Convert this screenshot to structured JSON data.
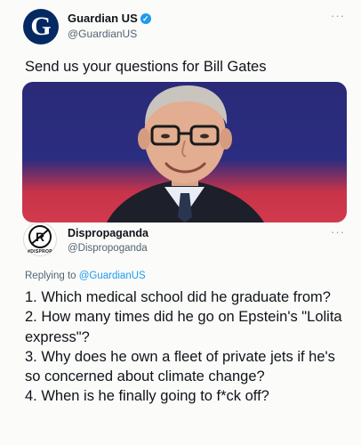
{
  "tweet1": {
    "display_name": "Guardian US",
    "handle": "@GuardianUS",
    "avatar_letter": "G",
    "text": "Send us your questions for Bill Gates",
    "more": "···"
  },
  "tweet2": {
    "display_name": "Dispropaganda",
    "handle": "@Dispropoganda",
    "avatar_letter": "R",
    "avatar_caption": "#DISPROP",
    "more": "···",
    "replying_prefix": "Replying to ",
    "replying_handle": "@GuardianUS",
    "questions": [
      "1. Which medical school did he graduate from?",
      "2. How many times did he go on Epstein's \"Lolita express\"?",
      "3. Why does he own a fleet of private jets if he's so concerned about climate change?",
      "4. When is he finally going to f*ck off?"
    ]
  },
  "colors": {
    "guardian_blue": "#052962",
    "verified_blue": "#1d9bf0",
    "link_blue": "#1d9bf0"
  }
}
